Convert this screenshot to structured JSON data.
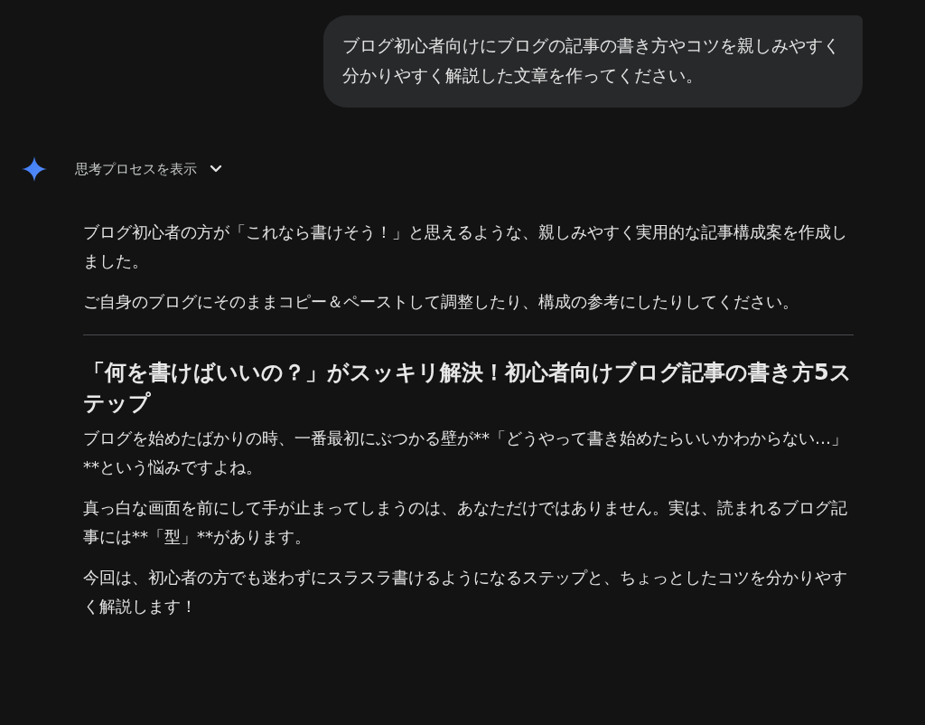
{
  "user_message": {
    "text": "ブログ初心者向けにブログの記事の書き方やコツを親しみやすく分かりやすく解説した文章を作ってください。"
  },
  "thinking_toggle": {
    "label": "思考プロセスを表示",
    "expanded": false
  },
  "response": [
    {
      "kind": "paragraph",
      "text": "ブログ初心者の方が「これなら書けそう！」と思えるような、親しみやすく実用的な記事構成案を作成しました。"
    },
    {
      "kind": "paragraph",
      "text": "ご自身のブログにそのままコピー＆ペーストして調整したり、構成の参考にしたりしてください。"
    },
    {
      "kind": "divider"
    },
    {
      "kind": "heading",
      "text": "「何を書けばいいの？」がスッキリ解決！初心者向けブログ記事の書き方5ステップ"
    },
    {
      "kind": "paragraph",
      "text": "ブログを始めたばかりの時、一番最初にぶつかる壁が**「どうやって書き始めたらいいかわからない…」**という悩みですよね。"
    },
    {
      "kind": "paragraph",
      "text": "真っ白な画面を前にして手が止まってしまうのは、あなただけではありません。実は、読まれるブログ記事には**「型」**があります。"
    },
    {
      "kind": "paragraph",
      "text": "今回は、初心者の方でも迷わずにスラスラ書けるようになるステップと、ちょっとしたコツを分かりやすく解説します！"
    }
  ]
}
